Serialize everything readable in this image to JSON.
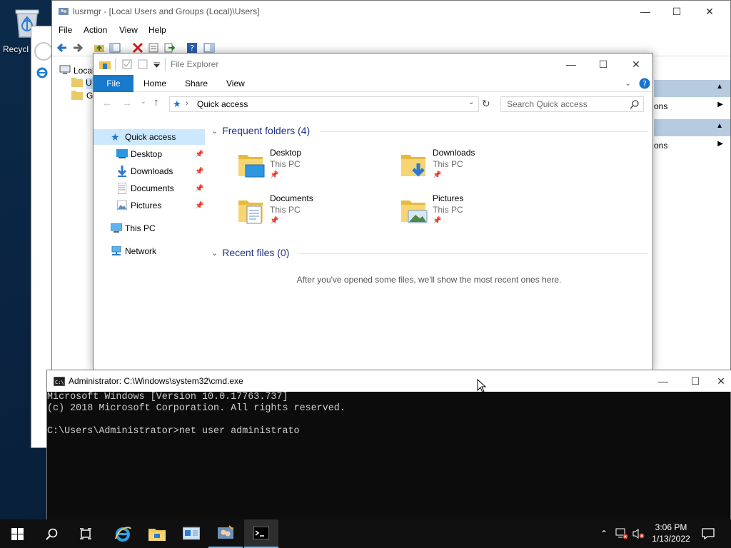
{
  "desktop": {
    "recycle_label": "Recycl"
  },
  "lusrmgr": {
    "title": "lusrmgr - [Local Users and Groups (Local)\\Users]",
    "menu": [
      "File",
      "Action",
      "View",
      "Help"
    ],
    "tree_root": "Local",
    "tree_children": [
      "U",
      "G"
    ],
    "actions": [
      "ons",
      "ons"
    ]
  },
  "explorer": {
    "title": "File Explorer",
    "ribbon_tabs": [
      "File",
      "Home",
      "Share",
      "View"
    ],
    "address": "Quick access",
    "search_placeholder": "Search Quick access",
    "nav": [
      {
        "label": "Quick access",
        "icon": "star-icon"
      },
      {
        "label": "Desktop",
        "icon": "desktop-icon"
      },
      {
        "label": "Downloads",
        "icon": "download-icon"
      },
      {
        "label": "Documents",
        "icon": "documents-icon"
      },
      {
        "label": "Pictures",
        "icon": "pictures-icon"
      },
      {
        "label": "This PC",
        "icon": "computer-icon"
      },
      {
        "label": "Network",
        "icon": "network-icon"
      }
    ],
    "frequent_header": "Frequent folders (4)",
    "folders": [
      {
        "name": "Desktop",
        "location": "This PC"
      },
      {
        "name": "Downloads",
        "location": "This PC"
      },
      {
        "name": "Documents",
        "location": "This PC"
      },
      {
        "name": "Pictures",
        "location": "This PC"
      }
    ],
    "recent_header": "Recent files (0)",
    "recent_empty": "After you've opened some files, we'll show the most recent ones here."
  },
  "cmd": {
    "title": "Administrator: C:\\Windows\\system32\\cmd.exe",
    "lines": [
      "Microsoft Windows [Version 10.0.17763.737]",
      "(c) 2018 Microsoft Corporation. All rights reserved.",
      "",
      "C:\\Users\\Administrator>net user administrato"
    ]
  },
  "taskbar": {
    "time": "3:06 PM",
    "date": "1/13/2022"
  }
}
